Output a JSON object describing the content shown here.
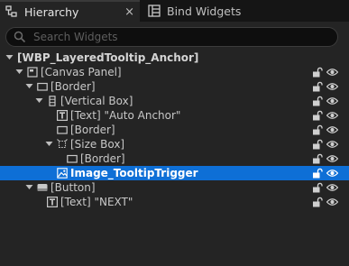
{
  "tabs": [
    {
      "label": "Hierarchy",
      "icon": "hierarchy-icon",
      "active": true,
      "close": "×"
    },
    {
      "label": "Bind Widgets",
      "icon": "bind-widgets-icon",
      "active": false
    }
  ],
  "search": {
    "placeholder": "Search Widgets",
    "value": ""
  },
  "tree": [
    {
      "label": "[WBP_LayeredTooltip_Anchor]",
      "depth": 0,
      "expanded": true,
      "icon": "none"
    },
    {
      "label": "[Canvas Panel]",
      "depth": 1,
      "expanded": true,
      "icon": "canvas-panel-icon"
    },
    {
      "label": "[Border]",
      "depth": 2,
      "expanded": true,
      "icon": "border-icon"
    },
    {
      "label": "[Vertical Box]",
      "depth": 3,
      "expanded": true,
      "icon": "vertical-box-icon"
    },
    {
      "label": "[Text] \"Auto Anchor\"",
      "depth": 4,
      "icon": "text-icon"
    },
    {
      "label": "[Border]",
      "depth": 4,
      "icon": "border-icon"
    },
    {
      "label": "[Size Box]",
      "depth": 4,
      "expanded": true,
      "icon": "size-box-icon"
    },
    {
      "label": "[Border]",
      "depth": 5,
      "icon": "border-icon"
    },
    {
      "label": "Image_TooltipTrigger",
      "depth": 4,
      "icon": "image-icon",
      "selected": true
    },
    {
      "label": "[Button]",
      "depth": 2,
      "expanded": true,
      "icon": "button-icon"
    },
    {
      "label": "[Text] \"NEXT\"",
      "depth": 3,
      "icon": "text-icon"
    }
  ],
  "colors": {
    "selection": "#0e6fd6",
    "panel": "#242424",
    "background": "#1a1a1a"
  }
}
